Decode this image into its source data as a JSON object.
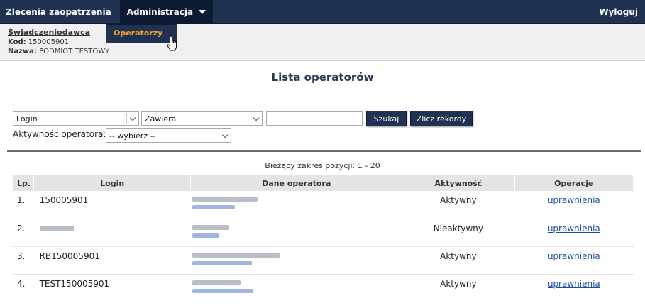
{
  "topbar": {
    "tab1": "Zlecenia zaopatrzenia",
    "tab2": "Administracja",
    "logout": "Wyloguj"
  },
  "dropdown": {
    "item": "Operatorzy"
  },
  "info": {
    "heading": "Świadczeniodawca",
    "kod_label": "Kod:",
    "kod_value": "150005901",
    "nazwa_label": "Nazwa:",
    "nazwa_value": "PODMIOT TESTOWY"
  },
  "page_title": "Lista operatorów",
  "search": {
    "field_value": "Login",
    "condition_value": "Zawiera",
    "text_value": "",
    "search_button": "Szukaj",
    "count_button": "Zlicz rekordy",
    "activity_label": "Aktywność operatora:",
    "activity_value": "-- wybierz --"
  },
  "range": "Bieżący zakres pozycji: 1 - 20",
  "table": {
    "headers": {
      "lp": "Lp.",
      "login": "Login",
      "dane": "Dane operatora",
      "aktyw": "Aktywność",
      "oper": "Operacje"
    },
    "rows": [
      {
        "lp": "1.",
        "login": "150005901",
        "status": "Aktywny",
        "action": "uprawnienia"
      },
      {
        "lp": "2.",
        "login": "",
        "status": "Nieaktywny",
        "action": "uprawnienia"
      },
      {
        "lp": "3.",
        "login": "RB150005901",
        "status": "Aktywny",
        "action": "uprawnienia"
      },
      {
        "lp": "4.",
        "login": "TEST150005901",
        "status": "Aktywny",
        "action": "uprawnienia"
      }
    ]
  },
  "colors": {
    "nav": "#1f3252",
    "accent": "#f4a52a",
    "link": "#1a4da0"
  }
}
